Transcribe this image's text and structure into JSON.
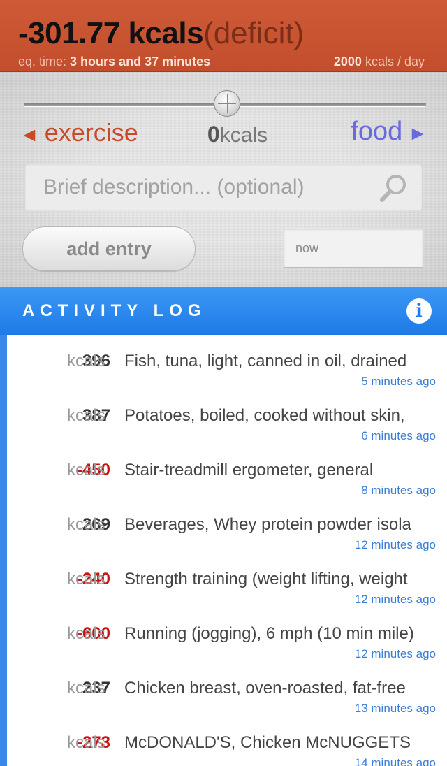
{
  "header": {
    "balance_value": "-301.77 kcals",
    "balance_tag": "(deficit)",
    "eq_time_label": "eq. time:",
    "eq_time_value": "3 hours and 37 minutes",
    "daily_target_value": "2000",
    "daily_target_unit": "kcals / day"
  },
  "entry": {
    "exercise_arrow": "◄",
    "exercise_label": "exercise",
    "kcal_value": "0",
    "kcal_unit": "kcals",
    "food_label": "food",
    "food_arrow": "►",
    "slider_position": 0.5,
    "description_placeholder": "Brief description... (optional)",
    "add_button_label": "add entry",
    "time_value": "now"
  },
  "log": {
    "title": "ACTIVITY LOG",
    "info_icon": "info-icon",
    "rows": [
      {
        "kcal": "396",
        "unit": "kcals",
        "description": "Fish, tuna, light, canned in oil, drained",
        "time": "5 minutes ago"
      },
      {
        "kcal": "387",
        "unit": "kcals",
        "description": "Potatoes, boiled, cooked without skin,",
        "time": "6 minutes ago"
      },
      {
        "kcal": "-450",
        "unit": "kcals",
        "description": "Stair-treadmill ergometer, general",
        "time": "8 minutes ago"
      },
      {
        "kcal": "269",
        "unit": "kcals",
        "description": "Beverages, Whey protein powder isola",
        "time": "12 minutes ago"
      },
      {
        "kcal": "-240",
        "unit": "kcals",
        "description": "Strength training (weight lifting, weight",
        "time": "12 minutes ago"
      },
      {
        "kcal": "-600",
        "unit": "kcals",
        "description": "Running (jogging), 6 mph (10 min mile)",
        "time": "12 minutes ago"
      },
      {
        "kcal": "237",
        "unit": "kcals",
        "description": "Chicken breast, oven-roasted, fat-free",
        "time": "13 minutes ago"
      },
      {
        "kcal": "-273",
        "unit": "kcals",
        "description": "McDONALD'S, Chicken McNUGGETS",
        "time": "14 minutes ago"
      }
    ]
  },
  "colors": {
    "header_bg": "#c9532f",
    "exercise": "#c94a2a",
    "food": "#6a6ae0",
    "log_bar": "#2a88ee",
    "negative": "#cc1111",
    "timestamp": "#3a7ed6"
  }
}
